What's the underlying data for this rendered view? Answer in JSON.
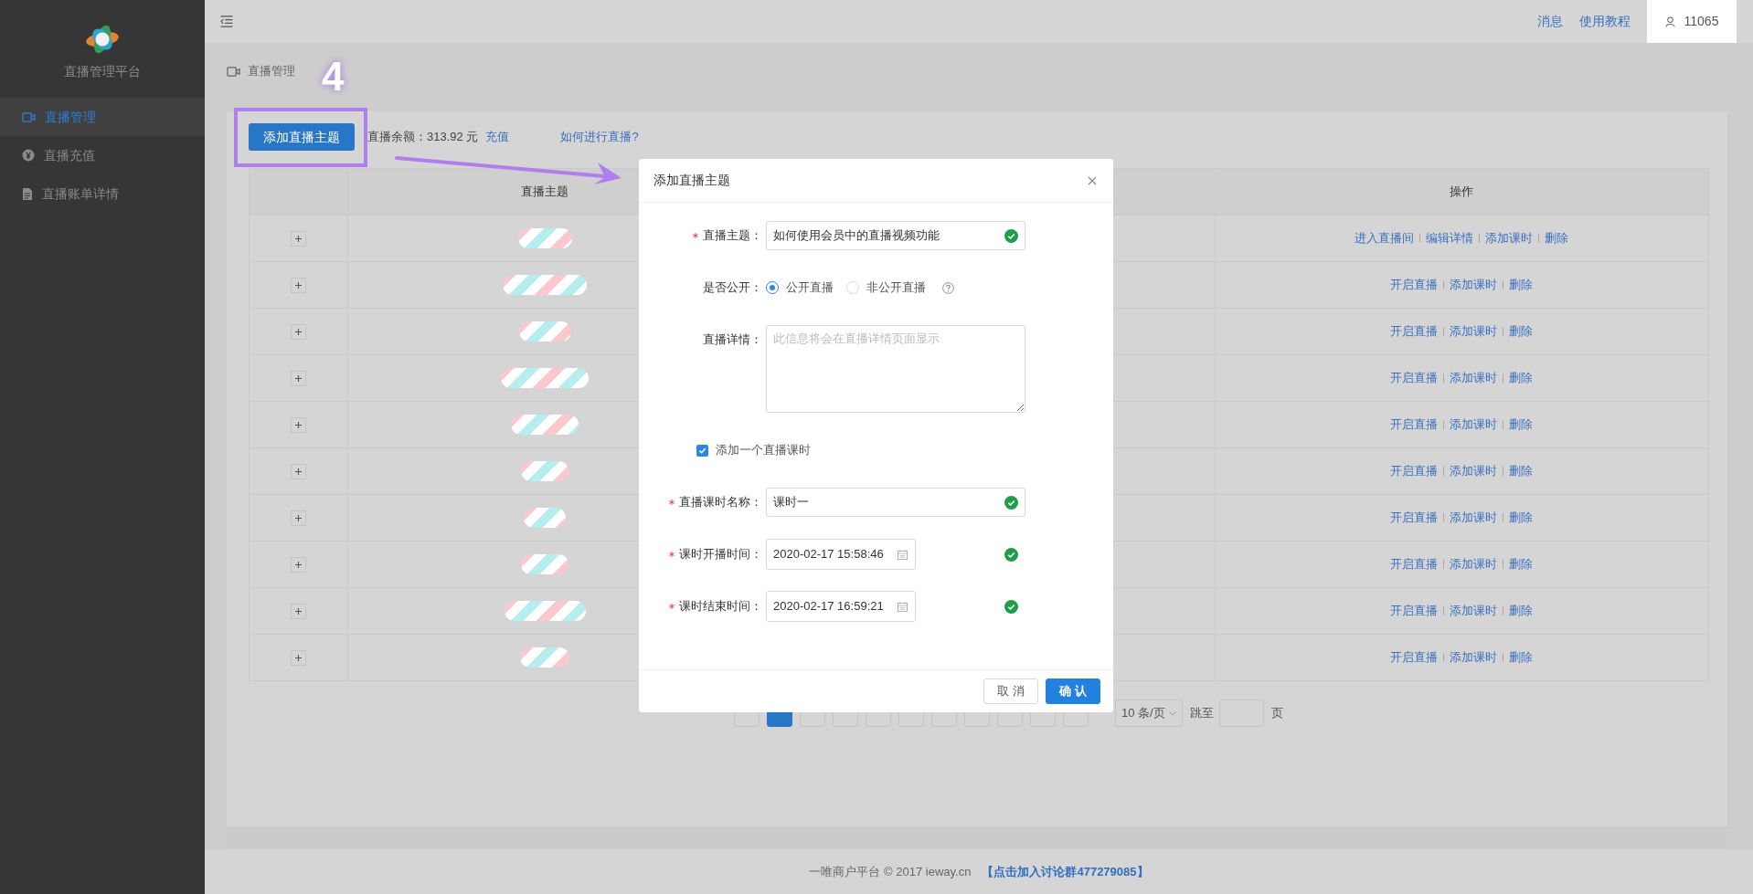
{
  "sidebar": {
    "title": "直播管理平台",
    "items": [
      {
        "kind": "video",
        "label": "直播管理",
        "selected": true
      },
      {
        "kind": "yen",
        "label": "直播充值",
        "selected": false
      },
      {
        "kind": "document",
        "label": "直播账单详情",
        "selected": false
      }
    ]
  },
  "topbar": {
    "links": [
      "消息",
      "使用教程"
    ],
    "user": "11065"
  },
  "breadcrumb": "直播管理",
  "toolbar": {
    "add_button": "添加直播主题",
    "balance": "直播余额：313.92 元",
    "recharge_link": "充值",
    "help_link": "如何进行直播?"
  },
  "table": {
    "columns": [
      "",
      "直播主题",
      "",
      "",
      "操作"
    ],
    "rows": [
      {
        "actions": [
          "进入直播间",
          "编辑详情",
          "添加课时",
          "删除"
        ]
      },
      {
        "actions": [
          "开启直播",
          "添加课时",
          "删除"
        ]
      },
      {
        "actions": [
          "开启直播",
          "添加课时",
          "删除"
        ]
      },
      {
        "actions": [
          "开启直播",
          "添加课时",
          "删除"
        ]
      },
      {
        "actions": [
          "开启直播",
          "添加课时",
          "删除"
        ]
      },
      {
        "actions": [
          "开启直播",
          "添加课时",
          "删除"
        ]
      },
      {
        "actions": [
          "开启直播",
          "添加课时",
          "删除"
        ]
      },
      {
        "actions": [
          "开启直播",
          "添加课时",
          "删除"
        ]
      },
      {
        "actions": [
          "开启直播",
          "添加课时",
          "删除"
        ]
      },
      {
        "actions": [
          "开启直播",
          "添加课时",
          "删除"
        ]
      }
    ]
  },
  "pagination": {
    "pages": [
      {
        "selected": true
      },
      {
        "selected": false
      },
      {
        "selected": false
      },
      {
        "selected": false
      },
      {
        "selected": false
      },
      {
        "selected": false
      },
      {
        "selected": false
      },
      {
        "selected": false
      },
      {
        "selected": false
      }
    ],
    "page_size": "10 条/页",
    "jump_label": "跳至",
    "page_unit": "页"
  },
  "dialog": {
    "title": "添加直播主题",
    "fields": [
      {
        "kind": "text",
        "label": "直播主题：",
        "required": true,
        "value": "如何使用会员中的直播视频功能",
        "valid": true
      },
      {
        "kind": "radio",
        "label": "是否公开：",
        "options": [
          {
            "label": "公开直播",
            "selected": true
          },
          {
            "label": "非公开直播",
            "selected": false
          }
        ]
      },
      {
        "kind": "textarea",
        "label": "直播详情：",
        "placeholder": "此信息将会在直播详情页面显示"
      },
      {
        "kind": "checkbox",
        "label": "添加一个直播课时",
        "checked": true
      },
      {
        "kind": "text",
        "label": "直播课时名称：",
        "required": true,
        "value": "课时一",
        "valid": true
      },
      {
        "kind": "date",
        "label": "课时开播时间：",
        "required": true,
        "value": "2020-02-17 15:58:46",
        "valid": true
      },
      {
        "kind": "date",
        "label": "课时结束时间：",
        "required": true,
        "value": "2020-02-17 16:59:21",
        "valid": true
      }
    ],
    "buttons": [
      {
        "kind": "default",
        "label": "取 消"
      },
      {
        "kind": "primary",
        "label": "确 认"
      }
    ]
  },
  "annotation": {
    "step": "4"
  },
  "footer": {
    "text": "一唯商户平台 © 2017 ieway.cn",
    "link": "【点击加入讨论群477279085】"
  }
}
